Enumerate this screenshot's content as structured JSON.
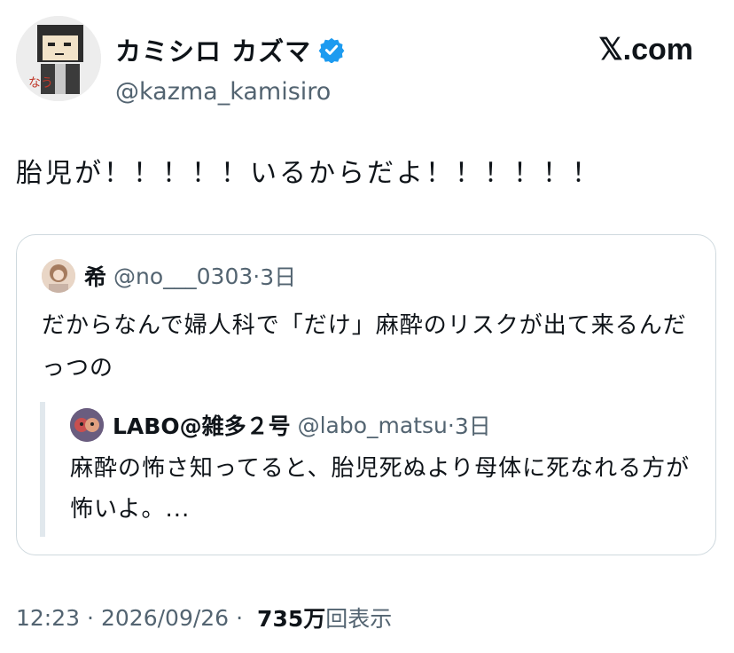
{
  "brand": {
    "label": "𝕏.com"
  },
  "author": {
    "name": "カミシロ カズマ",
    "handle": "@kazma_kamisiro",
    "avatar_text": "なう",
    "verified_color": "#1d9bf0"
  },
  "tweet": {
    "text": "胎児が！！！！！いるからだよ！！！！！！"
  },
  "quote": {
    "name": "希",
    "handle": "@no___0303",
    "separator": "·",
    "time": "3日",
    "text": "だからなんで婦人科で「だけ」麻酔のリスクが出て来るんだっつの",
    "nested": {
      "name": "LABO@雑多２号",
      "handle": "@labo_matsu",
      "separator": "·",
      "time": "3日",
      "text": "麻酔の怖さ知ってると、胎児死ぬより母体に死なれる方が怖いよ。..."
    }
  },
  "footer": {
    "time": "12:23",
    "separator": "·",
    "date": "2026/09/26",
    "views_count": "735万",
    "views_label": "回表示"
  },
  "colors": {
    "text": "#0f1419",
    "muted": "#536471",
    "border": "#cfd9de"
  }
}
